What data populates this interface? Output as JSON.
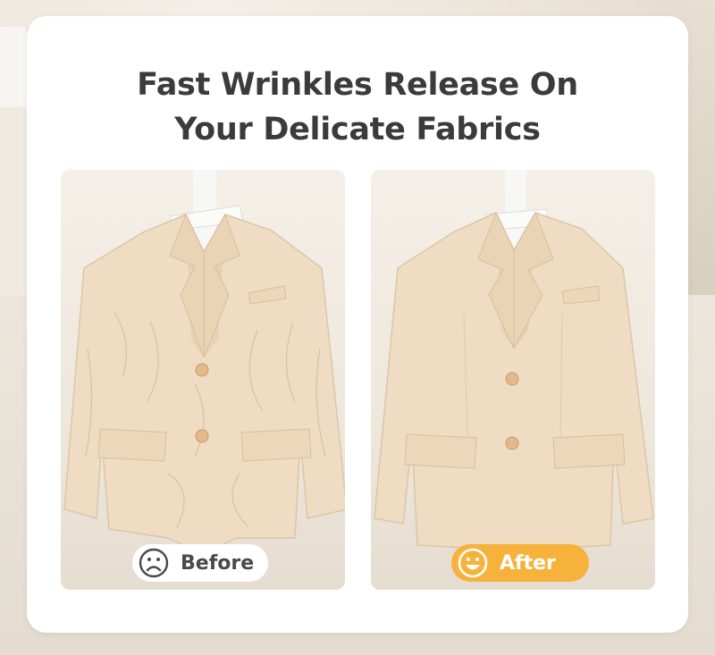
{
  "headline": {
    "line1": "Fast Wrinkles Release On",
    "line2": "Your Delicate Fabrics"
  },
  "comparison": {
    "before": {
      "label": "Before",
      "icon": "sad-face-icon",
      "pill_color": "#ffffff",
      "text_color": "#4a4a4a"
    },
    "after": {
      "label": "After",
      "icon": "happy-face-icon",
      "pill_color": "#f6b23a",
      "text_color": "#ffffff"
    }
  },
  "colors": {
    "heading": "#3b3b3b",
    "blazer": "#efdcc2",
    "accent": "#f6b23a"
  }
}
